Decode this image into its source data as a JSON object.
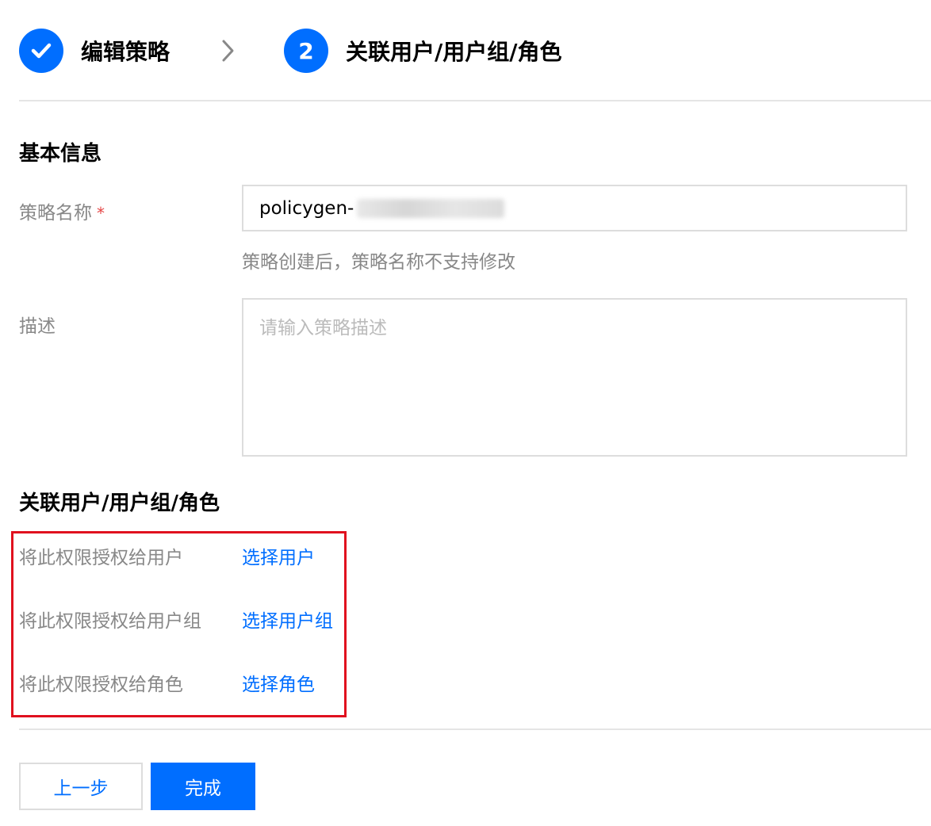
{
  "steps": {
    "step1": {
      "label": "编辑策略",
      "state": "completed"
    },
    "step2": {
      "number": "2",
      "label": "关联用户/用户组/角色",
      "state": "active"
    }
  },
  "basic_info": {
    "title": "基本信息",
    "policy_name": {
      "label": "策略名称",
      "required_mark": "*",
      "value_prefix": "policygen-",
      "hint": "策略创建后，策略名称不支持修改"
    },
    "description": {
      "label": "描述",
      "placeholder": "请输入策略描述"
    }
  },
  "association": {
    "title": "关联用户/用户组/角色",
    "rows": [
      {
        "label": "将此权限授权给用户",
        "link": "选择用户"
      },
      {
        "label": "将此权限授权给用户组",
        "link": "选择用户组"
      },
      {
        "label": "将此权限授权给角色",
        "link": "选择角色"
      }
    ]
  },
  "footer": {
    "prev_label": "上一步",
    "done_label": "完成"
  },
  "colors": {
    "accent": "#006eff",
    "highlight_border": "#e0101e",
    "label_gray": "#888888",
    "required": "#e54545"
  }
}
